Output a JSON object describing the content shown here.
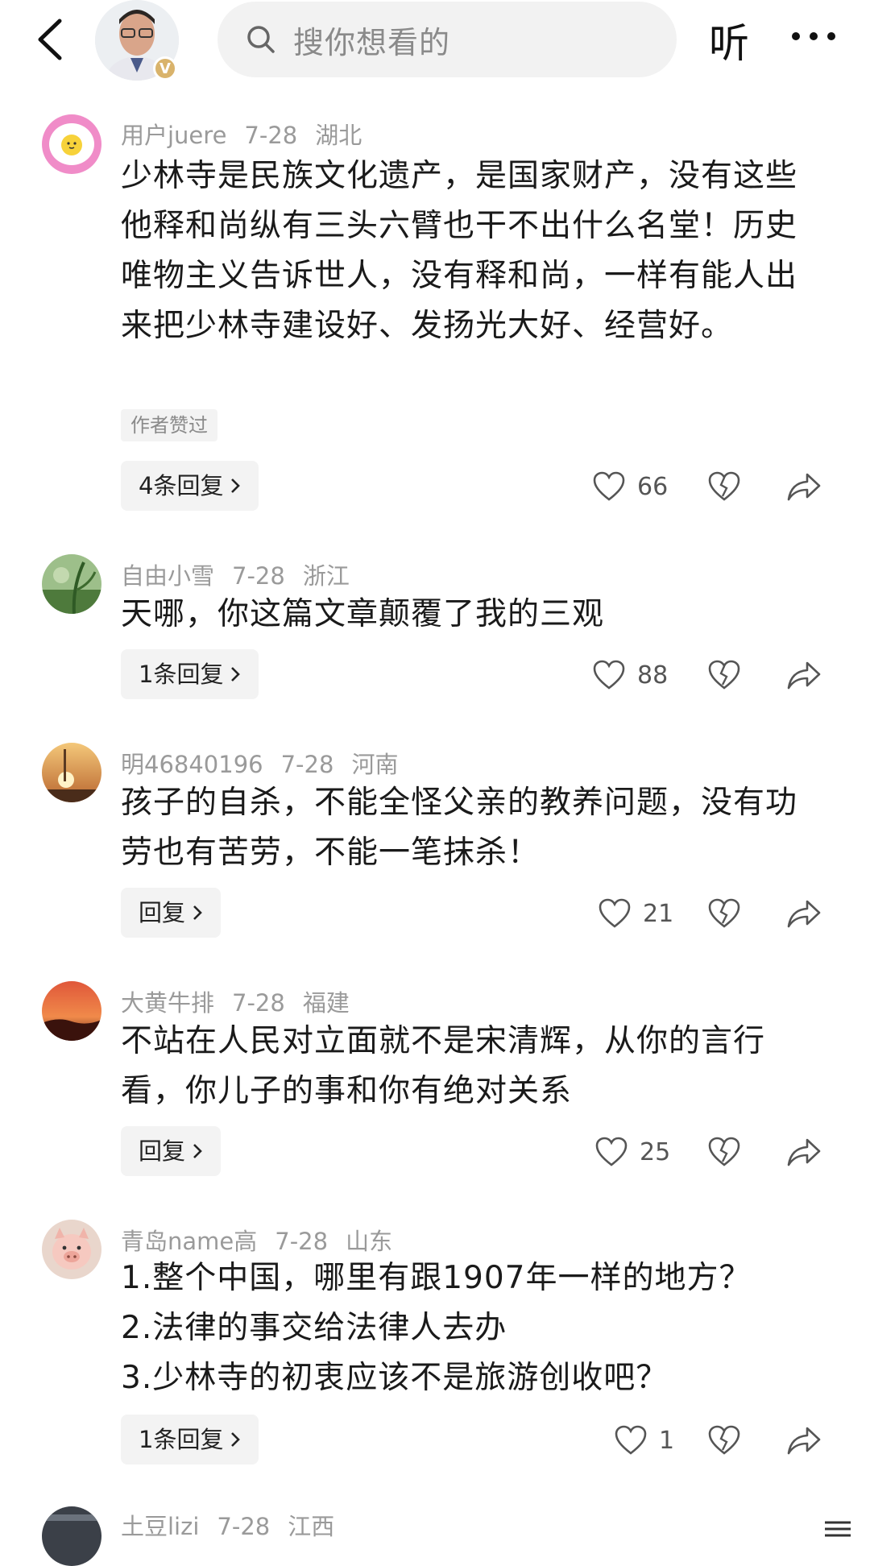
{
  "header": {
    "search_placeholder": "搜你想看的",
    "listen_label": "听",
    "author_badge": "V"
  },
  "comments": [
    {
      "user": "用户juere",
      "date": "7-28",
      "region": "湖北",
      "text": "少林寺是民族文化遗产，是国家财产，没有这些他释和尚纵有三头六臂也干不出什么名堂！历史唯物主义告诉世人，没有释和尚，一样有能人出来把少林寺建设好、发扬光大好、经营好。",
      "author_liked": "作者赞过",
      "reply_label": "4条回复",
      "likes": "66"
    },
    {
      "user": "自由小雪",
      "date": "7-28",
      "region": "浙江",
      "text": "天哪，你这篇文章颠覆了我的三观",
      "reply_label": "1条回复",
      "likes": "88"
    },
    {
      "user": "明46840196",
      "date": "7-28",
      "region": "河南",
      "text": "孩子的自杀，不能全怪父亲的教养问题，没有功劳也有苦劳，不能一笔抹杀！",
      "reply_label": "回复",
      "likes": "21"
    },
    {
      "user": "大黄牛排",
      "date": "7-28",
      "region": "福建",
      "text": "不站在人民对立面就不是宋清辉，从你的言行看，你儿子的事和你有绝对关系",
      "reply_label": "回复",
      "likes": "25"
    },
    {
      "user": "青岛name高",
      "date": "7-28",
      "region": "山东",
      "lines": [
        "1.整个中国，哪里有跟1907年一样的地方？",
        "2.法律的事交给法律人去办",
        "3.少林寺的初衷应该不是旅游创收吧？"
      ],
      "reply_label": "1条回复",
      "likes": "1"
    },
    {
      "user": "土豆lizi",
      "date": "7-28",
      "region": "江西"
    }
  ]
}
